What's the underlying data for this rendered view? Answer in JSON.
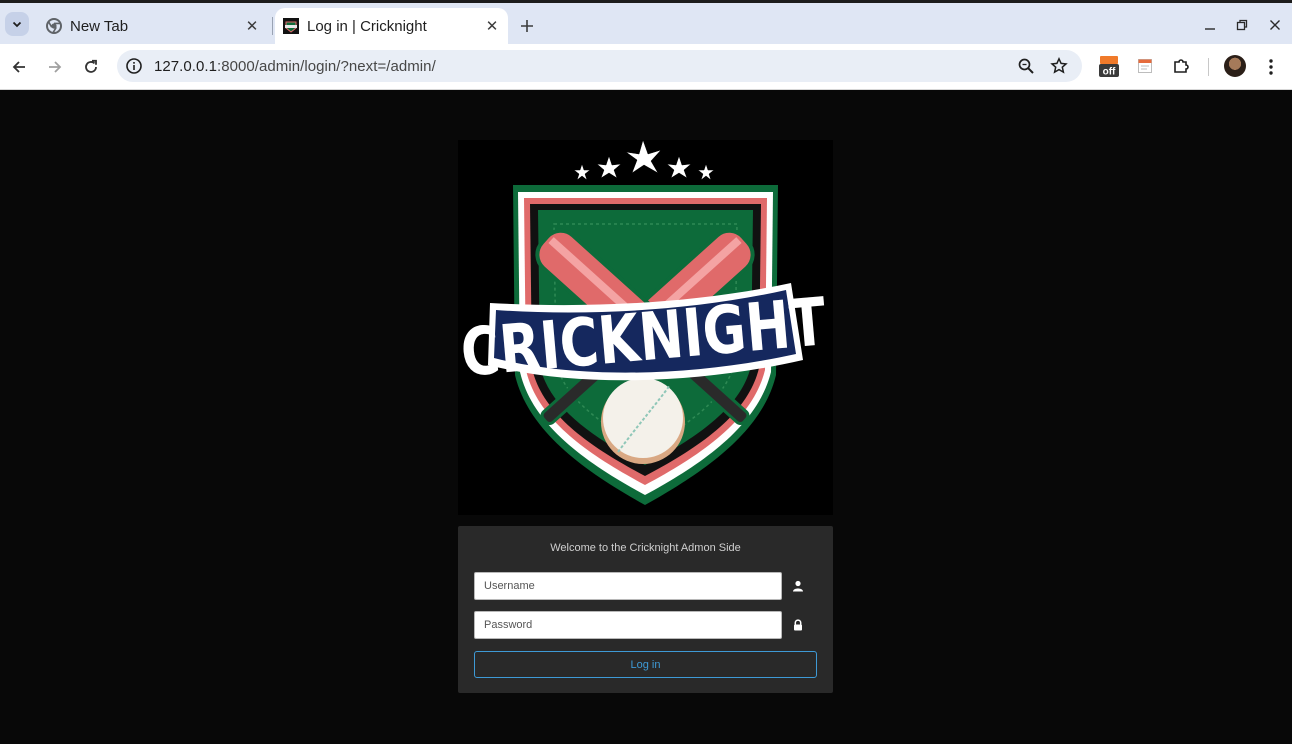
{
  "browser": {
    "tabs": [
      {
        "title": "New Tab",
        "active": false
      },
      {
        "title": "Log in | Cricknight",
        "active": true
      }
    ],
    "url_host": "127.0.0.1",
    "url_path": ":8000/admin/login/?next=/admin/",
    "extension_badge": "off"
  },
  "logo": {
    "text": "CRICKNIGHT",
    "colors": {
      "shield_green": "#0d6b3a",
      "bat_red": "#e06a6a",
      "banner_navy": "#15285e",
      "background": "#000000"
    }
  },
  "login": {
    "welcome": "Welcome to the Cricknight Admon Side",
    "username_placeholder": "Username",
    "password_placeholder": "Password",
    "submit_label": "Log in"
  },
  "colors": {
    "page_bg": "#080808",
    "panel_bg": "#292929",
    "accent": "#3e9ad6"
  }
}
